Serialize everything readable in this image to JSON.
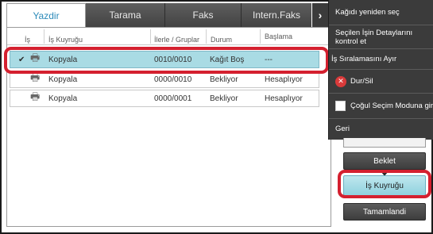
{
  "tabs": [
    "Yazdir",
    "Tarama",
    "Faks",
    "Intern.Faks"
  ],
  "columns": {
    "is": "İş",
    "queue": "İş Kuyruğu",
    "sets": "İlerle / Gruplar",
    "status": "Durum",
    "start": "Başlama"
  },
  "jobs": [
    {
      "name": "Kopyala",
      "sets": "0010/0010",
      "status": "Kağıt Boş",
      "start": "---"
    },
    {
      "name": "Kopyala",
      "sets": "0000/0010",
      "status": "Bekliyor",
      "start": "Hesaplıyor"
    },
    {
      "name": "Kopyala",
      "sets": "0000/0001",
      "status": "Bekliyor",
      "start": "Hesaplıyor"
    }
  ],
  "menu": {
    "chevron": "›",
    "items": [
      "Kağıdı yeniden seç",
      "Seçilen İşin Detaylarını kontrol et",
      "İş Sıralamasını Ayır",
      "Dur/Sil",
      "Çoğul Seçim Moduna gir",
      "Geri"
    ],
    "stop_symbol": "✕"
  },
  "buttons": {
    "hold": "Beklet",
    "job_queue": "İş Kuyruğu",
    "completed": "Tamamlandi"
  },
  "icons": {
    "check": "✔",
    "printer": "🖶"
  },
  "colors": {
    "selected_row": "#a9dbe4",
    "highlight": "#d4202f",
    "tab_active_text": "#2b8ab9"
  }
}
